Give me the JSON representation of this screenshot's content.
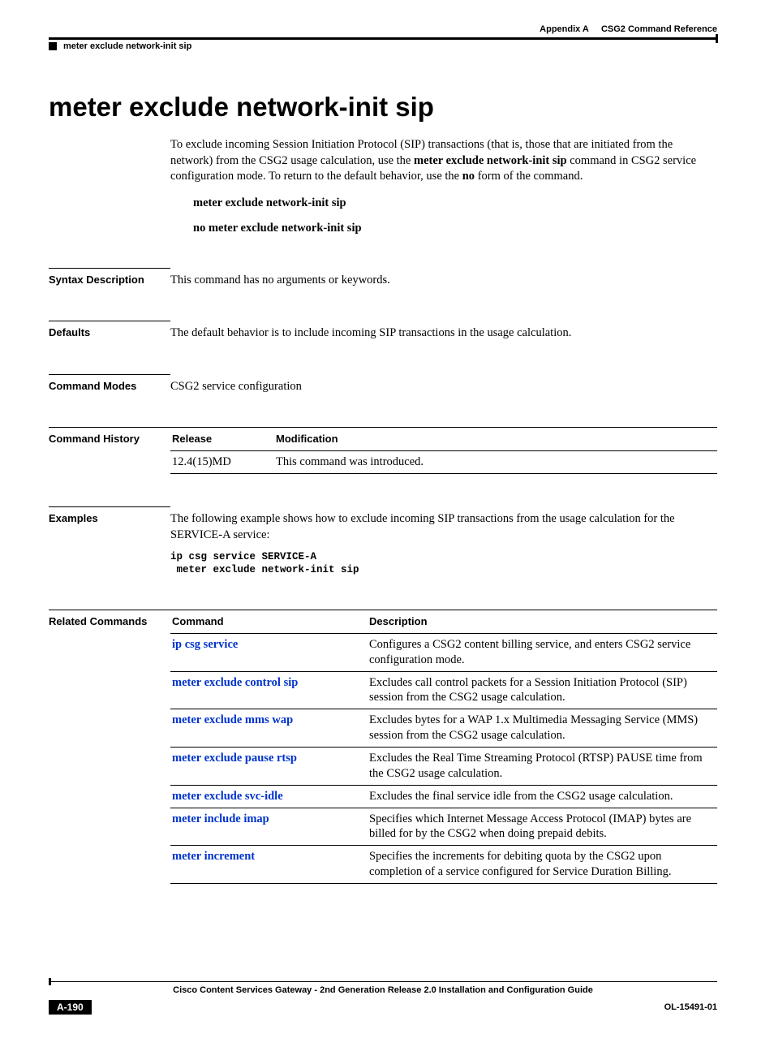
{
  "header": {
    "appendix": "Appendix A",
    "chapter": "CSG2 Command Reference",
    "section": "meter exclude network-init sip"
  },
  "title": "meter exclude network-init sip",
  "intro": {
    "p1a": "To exclude incoming Session Initiation Protocol (SIP) transactions (that is, those that are initiated from the network) from the CSG2 usage calculation, use the ",
    "p1b": "meter exclude network-init sip",
    "p1c": " command in CSG2 service configuration mode. To return to the default behavior, use the ",
    "p1d": "no",
    "p1e": " form of the command."
  },
  "syntax": {
    "line1": "meter exclude network-init sip",
    "line2": "no meter exclude network-init sip"
  },
  "sections": {
    "syntax_desc_label": "Syntax Description",
    "syntax_desc_body": "This command has no arguments or keywords.",
    "defaults_label": "Defaults",
    "defaults_body": "The default behavior is to include incoming SIP transactions in the usage calculation.",
    "modes_label": "Command Modes",
    "modes_body": "CSG2 service configuration",
    "history_label": "Command History",
    "examples_label": "Examples",
    "examples_body": "The following example shows how to exclude incoming SIP transactions from the usage calculation for the SERVICE-A service:",
    "examples_code": "ip csg service SERVICE-A\n meter exclude network-init sip",
    "related_label": "Related Commands"
  },
  "history": {
    "col_release": "Release",
    "col_mod": "Modification",
    "rows": [
      {
        "release": "12.4(15)MD",
        "mod": "This command was introduced."
      }
    ]
  },
  "related": {
    "col_cmd": "Command",
    "col_desc": "Description",
    "rows": [
      {
        "cmd": "ip csg service",
        "desc": "Configures a CSG2 content billing service, and enters CSG2 service configuration mode."
      },
      {
        "cmd": "meter exclude control sip",
        "desc": "Excludes call control packets for a Session Initiation Protocol (SIP) session from the CSG2 usage calculation."
      },
      {
        "cmd": "meter exclude mms wap",
        "desc": "Excludes bytes for a WAP 1.x Multimedia Messaging Service (MMS) session from the CSG2 usage calculation."
      },
      {
        "cmd": "meter exclude pause rtsp",
        "desc": "Excludes the Real Time Streaming Protocol (RTSP) PAUSE time from the CSG2 usage calculation."
      },
      {
        "cmd": "meter exclude svc-idle",
        "desc": "Excludes the final service idle from the CSG2 usage calculation."
      },
      {
        "cmd": "meter include imap",
        "desc": "Specifies which Internet Message Access Protocol (IMAP) bytes are billed for by the CSG2 when doing prepaid debits."
      },
      {
        "cmd": "meter increment",
        "desc": "Specifies the increments for debiting quota by the CSG2 upon completion of a service configured for Service Duration Billing."
      }
    ]
  },
  "footer": {
    "guide": "Cisco Content Services Gateway - 2nd Generation Release 2.0 Installation and Configuration Guide",
    "page": "A-190",
    "docid": "OL-15491-01"
  }
}
